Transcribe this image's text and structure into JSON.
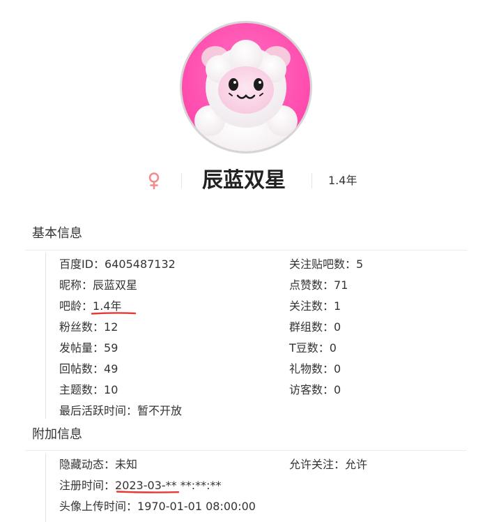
{
  "profile": {
    "username": "辰蓝双星",
    "age": "1.4年",
    "gender_icon": "female-icon",
    "accent_color": "#f38b8b",
    "avatar_description_icon": "white-sheep-avatar-icon"
  },
  "basic_info": {
    "title": "基本信息",
    "left": [
      {
        "label": "百度ID：",
        "value": "6405487132"
      },
      {
        "label": "昵称：",
        "value": "辰蓝双星"
      },
      {
        "label": "吧龄：",
        "value": "1.4年"
      },
      {
        "label": "粉丝数：",
        "value": "12"
      },
      {
        "label": "发帖量：",
        "value": "59"
      },
      {
        "label": "回帖数：",
        "value": "49"
      },
      {
        "label": "主题数：",
        "value": "10"
      },
      {
        "label": "最后活跃时间：",
        "value": "暂不开放"
      }
    ],
    "right": [
      {
        "label": "关注贴吧数：",
        "value": "5"
      },
      {
        "label": "点赞数：",
        "value": "71"
      },
      {
        "label": "关注数：",
        "value": "1"
      },
      {
        "label": "群组数：",
        "value": "0"
      },
      {
        "label": "T豆数：",
        "value": "0"
      },
      {
        "label": "礼物数：",
        "value": "0"
      },
      {
        "label": "访客数：",
        "value": "0"
      }
    ]
  },
  "extra_info": {
    "title": "附加信息",
    "left": [
      {
        "label": "隐藏动态：",
        "value": "未知"
      },
      {
        "label": "注册时间：",
        "value": "2023-03-** **:**:**"
      },
      {
        "label": "头像上传时间：",
        "value": "1970-01-01 08:00:00"
      }
    ],
    "right": [
      {
        "label": "允许关注：",
        "value": "允许"
      }
    ]
  },
  "annotation_color": "#e53935"
}
